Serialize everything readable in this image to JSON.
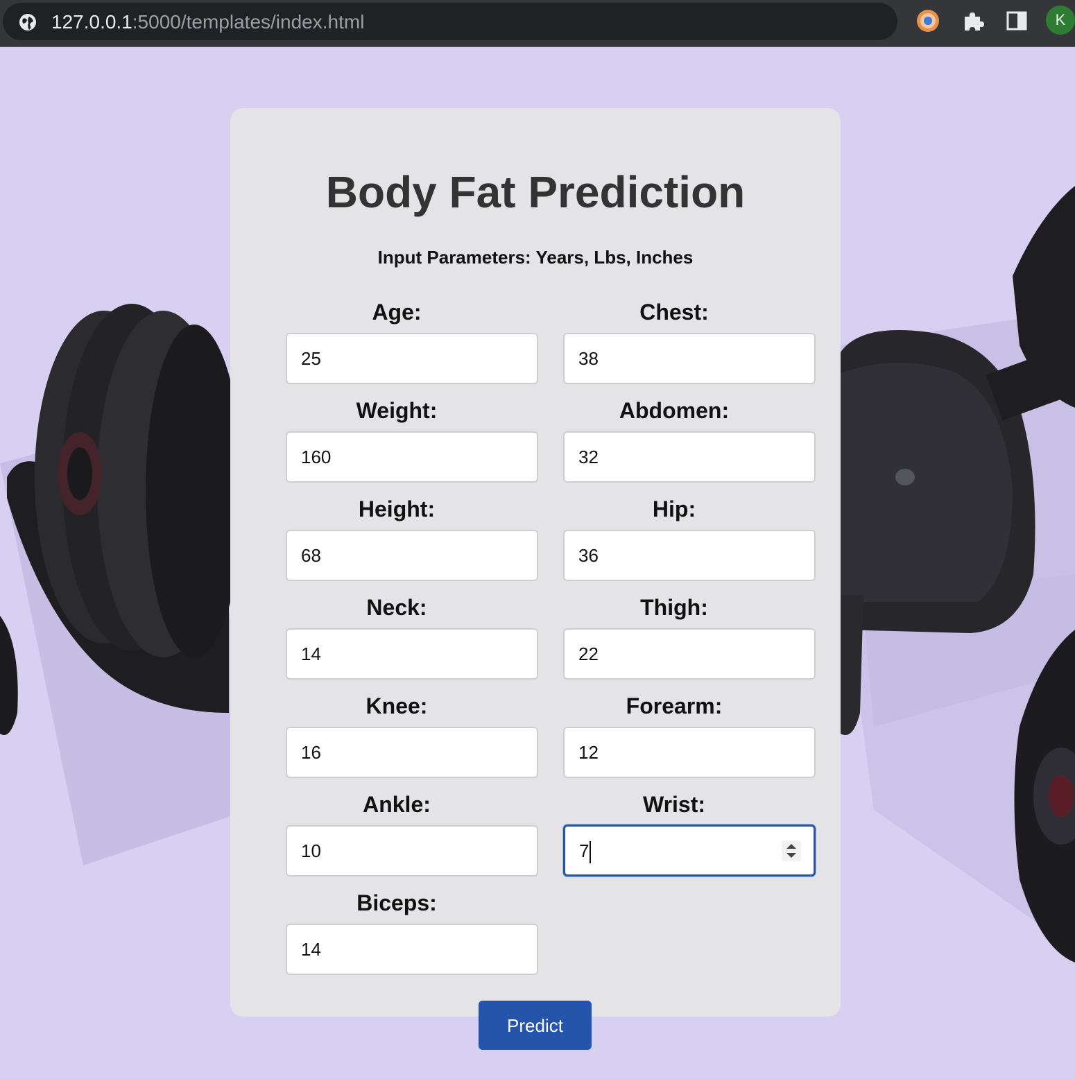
{
  "browser": {
    "url_host": "127.0.0.1",
    "url_rest": ":5000/templates/index.html",
    "profile_initial": "K",
    "icons": [
      "globe-icon",
      "extension-color-icon",
      "puzzle-icon",
      "side-panel-icon"
    ]
  },
  "page": {
    "title": "Body Fat Prediction",
    "subtitle": "Input Parameters: Years, Lbs, Inches"
  },
  "fields": {
    "age": {
      "label": "Age:",
      "value": "25"
    },
    "chest": {
      "label": "Chest:",
      "value": "38"
    },
    "weight": {
      "label": "Weight:",
      "value": "160"
    },
    "abdomen": {
      "label": "Abdomen:",
      "value": "32"
    },
    "height": {
      "label": "Height:",
      "value": "68"
    },
    "hip": {
      "label": "Hip:",
      "value": "36"
    },
    "neck": {
      "label": "Neck:",
      "value": "14"
    },
    "thigh": {
      "label": "Thigh:",
      "value": "22"
    },
    "knee": {
      "label": "Knee:",
      "value": "16"
    },
    "forearm": {
      "label": "Forearm:",
      "value": "12"
    },
    "ankle": {
      "label": "Ankle:",
      "value": "10"
    },
    "wrist": {
      "label": "Wrist:",
      "value": "7"
    },
    "biceps": {
      "label": "Biceps:",
      "value": "14"
    }
  },
  "predict_label": "Predict",
  "colors": {
    "background": "#d7d0f1",
    "card": "#e4e3e5",
    "button": "#2455ab",
    "focus": "#2457a8"
  }
}
